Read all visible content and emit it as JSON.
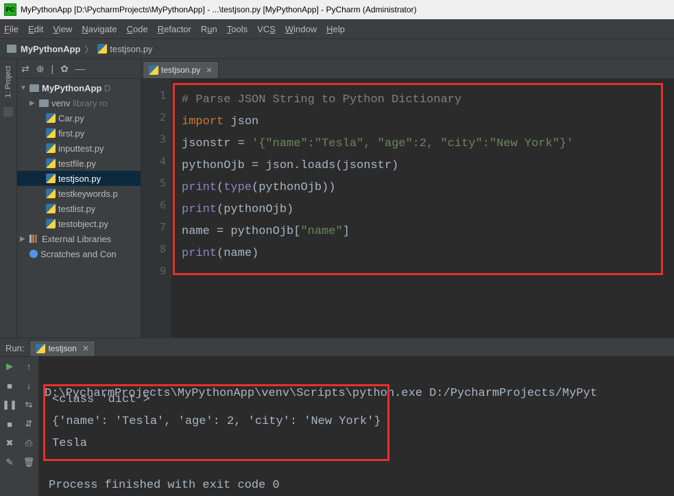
{
  "title": "MyPythonApp [D:\\PycharmProjects\\MyPythonApp] - ...\\testjson.py [MyPythonApp] - PyCharm (Administrator)",
  "logo": "PC",
  "menu": [
    "File",
    "Edit",
    "View",
    "Navigate",
    "Code",
    "Refactor",
    "Run",
    "Tools",
    "VCS",
    "Window",
    "Help"
  ],
  "crumb": {
    "project": "MyPythonApp",
    "file": "testjson.py"
  },
  "gutter": {
    "project_tab": "1: Project"
  },
  "sidebar_tools": {
    "collapse": "⇄",
    "target": "⊕",
    "sep": "|",
    "gear": "✿",
    "hide": "—"
  },
  "tree": {
    "root": "MyPythonApp",
    "root_hint": "D",
    "venv": "venv",
    "venv_hint": "library ro",
    "files": [
      "Car.py",
      "first.py",
      "inputtest.py",
      "testfile.py",
      "testjson.py",
      "testkeywords.p",
      "testlist.py",
      "testobject.py"
    ],
    "ext": "External Libraries",
    "scratch": "Scratches and Con"
  },
  "selected_file": "testjson.py",
  "editor_tab": "testjson.py",
  "line_numbers": [
    "1",
    "2",
    "3",
    "4",
    "5",
    "6",
    "7",
    "8",
    "9"
  ],
  "code": {
    "l1": "# Parse JSON String to Python Dictionary",
    "l2a": "import",
    "l2b": " json",
    "l3a": "jsonstr = ",
    "l3b": "'{\"name\":\"Tesla\", \"age\":2, \"city\":\"New York\"}'",
    "l4": "pythonOjb = json.loads(jsonstr)",
    "l5a": "print",
    "l5b": "(",
    "l5c": "type",
    "l5d": "(pythonOjb))",
    "l6a": "print",
    "l6b": "(pythonOjb)",
    "l7a": "name = pythonOjb[",
    "l7b": "\"name\"",
    "l7c": "]",
    "l8a": "print",
    "l8b": "(name)"
  },
  "run": {
    "label": "Run:",
    "tab": "testjson",
    "cmd": "D:\\PycharmProjects\\MyPythonApp\\venv\\Scripts\\python.exe D:/PycharmProjects/MyPyt",
    "out1": "<class 'dict'>",
    "out2": "{'name': 'Tesla', 'age': 2, 'city': 'New York'}",
    "out3": "Tesla",
    "exit": "Process finished with exit code 0"
  },
  "runtools": {
    "play": "▶",
    "up": "↑",
    "stop": "■",
    "down": "↓",
    "pause": "❚❚",
    "step": "⇆",
    "kill": "■",
    "wrap": "⇵",
    "x": "✖",
    "print": "⎙",
    "pin": "✎",
    "del": "🗑"
  }
}
